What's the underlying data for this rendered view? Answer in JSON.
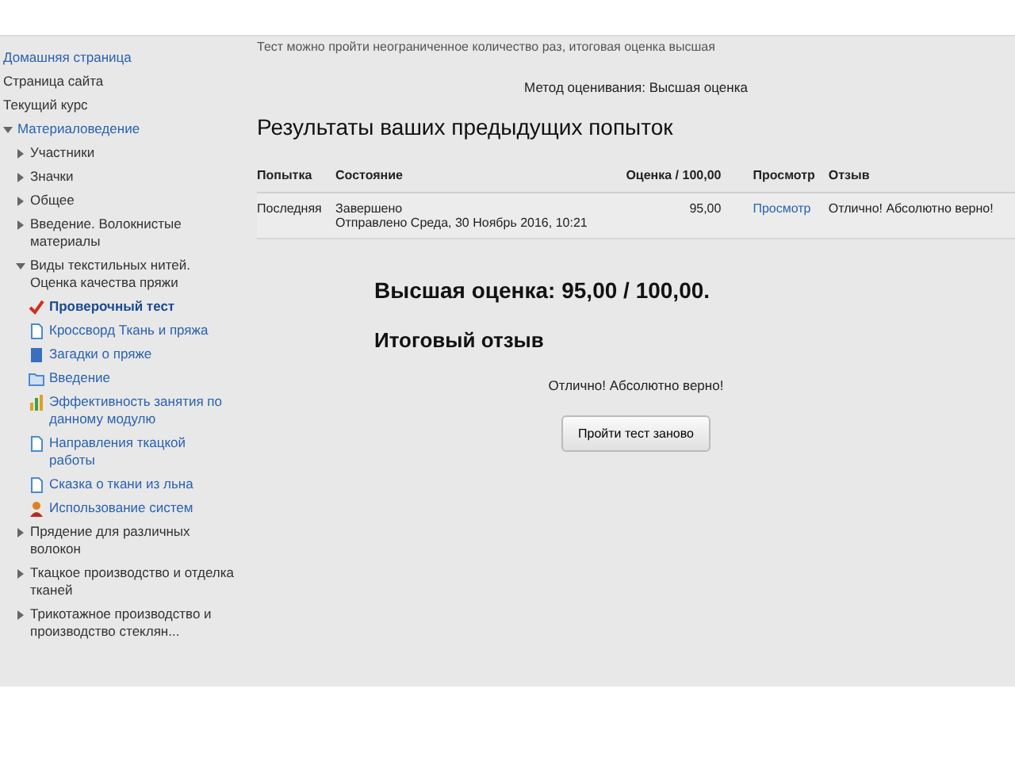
{
  "sidebar": {
    "items": [
      {
        "label": "Домашняя страница",
        "kind": "link",
        "expanded": false
      },
      {
        "label": "Страница сайта",
        "kind": "plain"
      },
      {
        "label": "Текущий курс",
        "kind": "plain"
      },
      {
        "label": "Материаловедение",
        "kind": "link",
        "expanded": true,
        "children": [
          {
            "label": "Участники",
            "expanded": false
          },
          {
            "label": "Значки",
            "expanded": false
          },
          {
            "label": "Общее",
            "expanded": false
          },
          {
            "label": "Введение. Волокнистые материалы",
            "expanded": false
          },
          {
            "label": "Виды текстильных нитей. Оценка качества пряжи",
            "expanded": true,
            "children": [
              {
                "label": "Проверочный тест",
                "kind": "quiz",
                "selected": true
              },
              {
                "label": "Кроссворд Ткань и пряжа",
                "kind": "page",
                "selected": false
              },
              {
                "label": "Загадки о пряже",
                "kind": "book",
                "selected": false
              },
              {
                "label": "Введение",
                "kind": "folder",
                "selected": false
              },
              {
                "label": "Эффективность занятия по данному модулю",
                "kind": "chart",
                "selected": false
              },
              {
                "label": "Направления ткацкой работы",
                "kind": "page",
                "selected": false
              },
              {
                "label": "Сказка о ткани из льна",
                "kind": "page",
                "selected": false
              },
              {
                "label": "Использование систем",
                "kind": "users",
                "selected": false
              }
            ]
          },
          {
            "label": "Прядение для различных волокон",
            "expanded": false
          },
          {
            "label": "Ткацкое производство и отделка тканей",
            "expanded": false
          },
          {
            "label": "Трикотажное производство и производство стеклян...",
            "expanded": false
          }
        ]
      }
    ]
  },
  "content": {
    "intro": "Тест можно пройти неограниченное количество раз, итоговая оценка высшая",
    "grading_method": "Метод оценивания: Высшая оценка",
    "heading": "Результаты ваших предыдущих попыток",
    "table": {
      "columns": [
        "Попытка",
        "Состояние",
        "Оценка / 100,00",
        "Просмотр",
        "Отзыв"
      ],
      "rows": [
        {
          "attempt": "Последняя",
          "state": "Завершено",
          "submitted": "Отправлено Среда, 30 Ноябрь 2016, 10:21",
          "grade": "95,00",
          "review": "Просмотр",
          "feedback": "Отлично! Абсолютно верно!"
        }
      ]
    },
    "best_grade": "Высшая оценка: 95,00 / 100,00.",
    "feedback_heading": "Итоговый отзыв",
    "feedback": "Отлично! Абсолютно верно!",
    "retake_button": "Пройти тест заново"
  }
}
